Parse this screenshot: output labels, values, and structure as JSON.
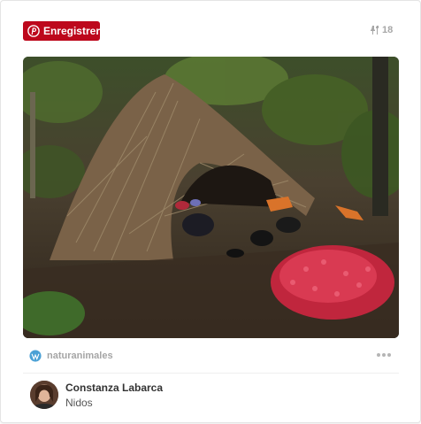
{
  "save_button": {
    "label": "Enregistrer",
    "icon": "pinterest-icon",
    "color": "#bd081c"
  },
  "repin": {
    "count": "18",
    "icon": "pin-icon"
  },
  "image": {
    "alt": "Bowerbird nest with berries"
  },
  "source": {
    "name": "naturanimales",
    "icon": "wordpress-icon"
  },
  "more_menu": {
    "icon": "ellipsis-icon"
  },
  "pinner": {
    "name": "Constanza Labarca",
    "board": "Nidos"
  }
}
